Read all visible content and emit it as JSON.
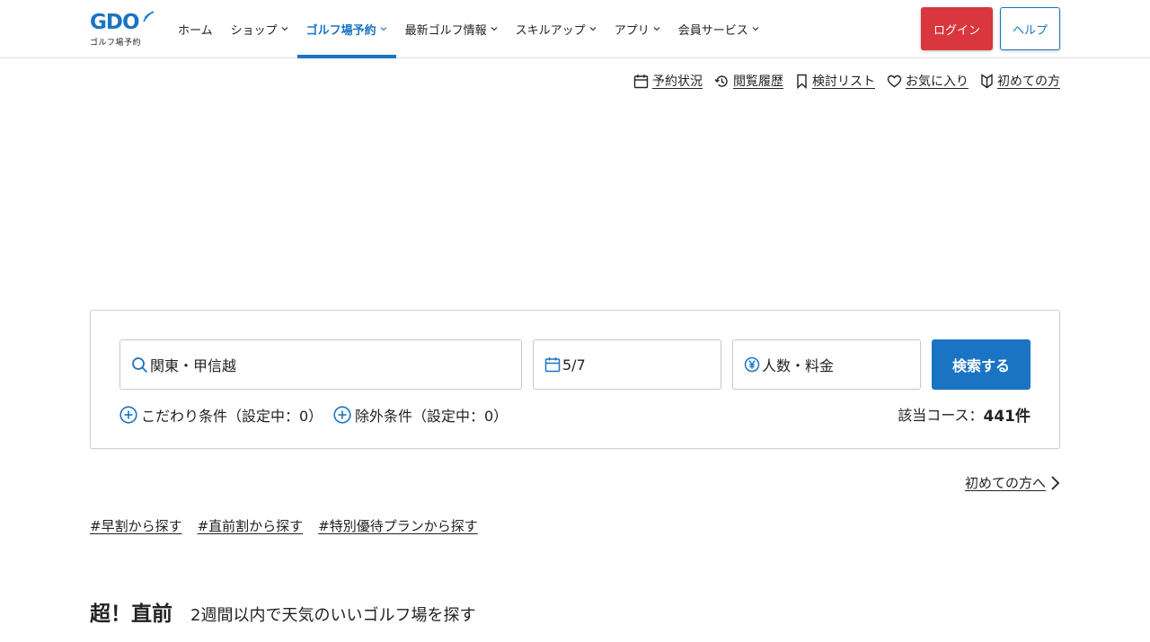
{
  "header": {
    "logo_mark": "GDO",
    "logo_sub": "ゴルフ場予約",
    "nav": [
      {
        "label": "ホーム",
        "dropdown": false,
        "active": false
      },
      {
        "label": "ショップ",
        "dropdown": true,
        "active": false
      },
      {
        "label": "ゴルフ場予約",
        "dropdown": true,
        "active": true
      },
      {
        "label": "最新ゴルフ情報",
        "dropdown": true,
        "active": false
      },
      {
        "label": "スキルアップ",
        "dropdown": true,
        "active": false
      },
      {
        "label": "アプリ",
        "dropdown": true,
        "active": false
      },
      {
        "label": "会員サービス",
        "dropdown": true,
        "active": false
      }
    ],
    "login_label": "ログイン",
    "help_label": "ヘルプ"
  },
  "utility_links": [
    {
      "label": "予約状況",
      "icon": "calendar-icon"
    },
    {
      "label": "閲覧履歴",
      "icon": "history-icon"
    },
    {
      "label": "検討リスト",
      "icon": "bookmark-icon"
    },
    {
      "label": "お気に入り",
      "icon": "heart-icon"
    },
    {
      "label": "初めての方",
      "icon": "beginner-icon"
    }
  ],
  "search": {
    "area_value": "関東・甲信越",
    "date_value": "5/7",
    "people_value": "人数・料金",
    "search_button": "検索する",
    "condition_label": "こだわり条件（設定中：0）",
    "exclude_label": "除外条件（設定中：0）",
    "count_prefix": "該当コース：",
    "count_value": "441件"
  },
  "first_time_link": "初めての方へ",
  "tags": [
    "#早割から探す",
    "#直前割から探す",
    "#特別優待プランから探す"
  ],
  "section": {
    "title": "超！直前",
    "subtitle": "2週間以内で天気のいいゴルフ場を探す"
  },
  "colors": {
    "brand_blue": "#1a74c3",
    "login_red": "#d9363e"
  }
}
